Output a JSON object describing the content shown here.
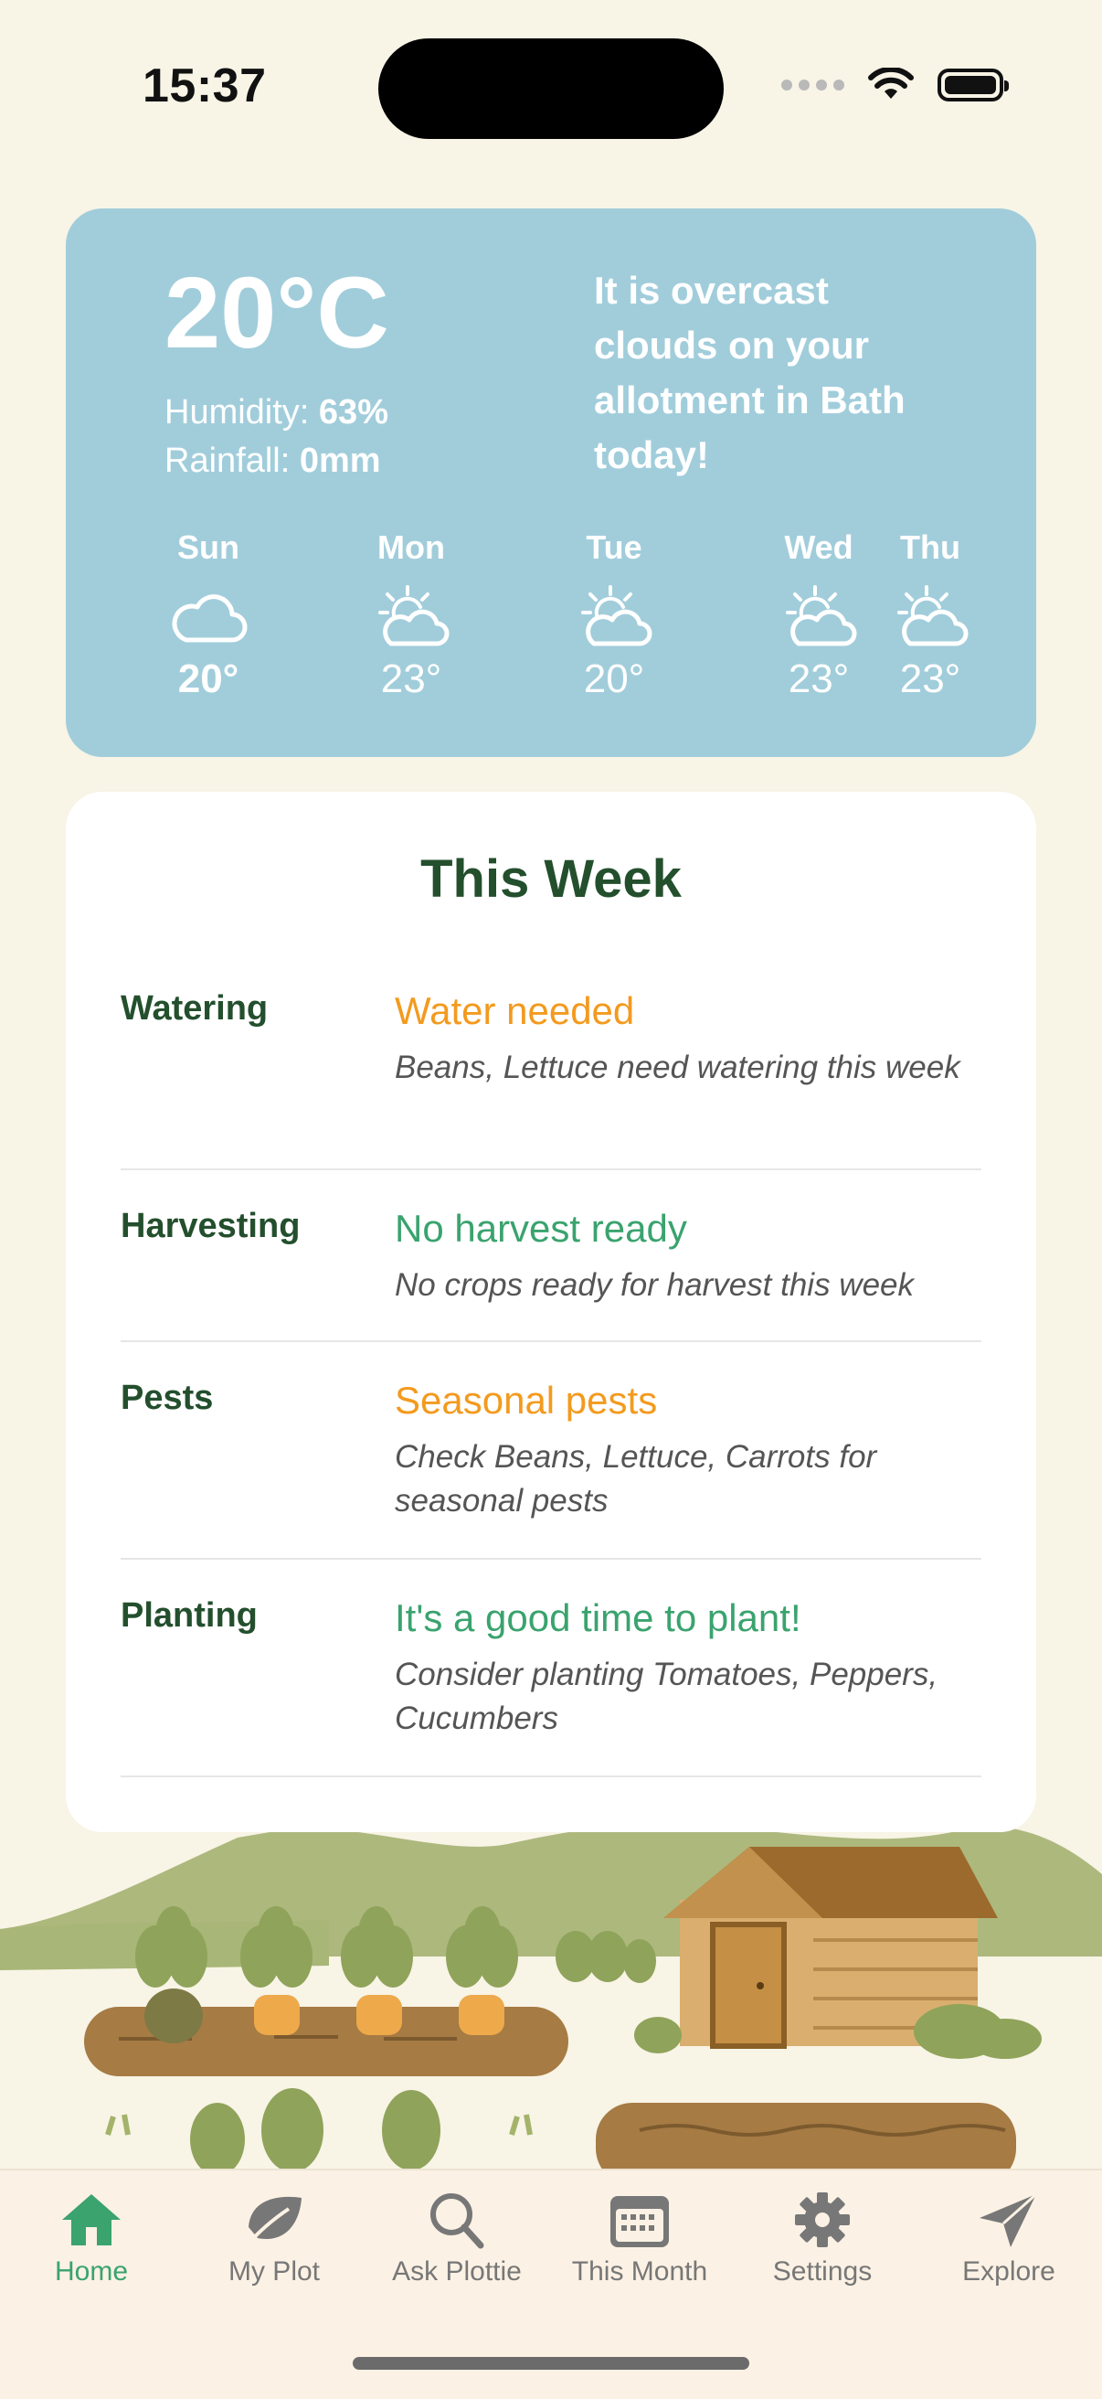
{
  "status_bar": {
    "time": "15:37"
  },
  "weather": {
    "temperature": "20°C",
    "humidity_label": "Humidity: ",
    "humidity_value": "63%",
    "rainfall_label": "Rainfall: ",
    "rainfall_value": "0mm",
    "summary": "It is overcast clouds on your allotment in Bath today!",
    "forecast": [
      {
        "day": "Sun",
        "temp": "20°",
        "icon": "cloud-icon"
      },
      {
        "day": "Mon",
        "temp": "23°",
        "icon": "partly-sunny-icon"
      },
      {
        "day": "Tue",
        "temp": "20°",
        "icon": "partly-sunny-icon"
      },
      {
        "day": "Wed",
        "temp": "23°",
        "icon": "partly-sunny-icon"
      },
      {
        "day": "Thu",
        "temp": "23°",
        "icon": "partly-sunny-icon"
      }
    ]
  },
  "this_week": {
    "title": "This Week",
    "rows": [
      {
        "label": "Watering",
        "status": "Water needed",
        "status_color": "#F39A1E",
        "detail": "Beans, Lettuce need watering this week"
      },
      {
        "label": "Harvesting",
        "status": "No harvest ready",
        "status_color": "#3AA36E",
        "detail": "No crops ready for harvest this week"
      },
      {
        "label": "Pests",
        "status": "Seasonal pests",
        "status_color": "#F39A1E",
        "detail": "Check Beans, Lettuce, Carrots for seasonal pests"
      },
      {
        "label": "Planting",
        "status": "It's a good time to plant!",
        "status_color": "#3AA36E",
        "detail": "Consider planting Tomatoes, Peppers, Cucumbers"
      }
    ]
  },
  "tabs": [
    {
      "label": "Home",
      "icon": "home-icon",
      "active": true
    },
    {
      "label": "My Plot",
      "icon": "leaf-icon",
      "active": false
    },
    {
      "label": "Ask Plottie",
      "icon": "search-icon",
      "active": false
    },
    {
      "label": "This Month",
      "icon": "calendar-icon",
      "active": false
    },
    {
      "label": "Settings",
      "icon": "gear-icon",
      "active": false
    },
    {
      "label": "Explore",
      "icon": "paper-plane-icon",
      "active": false
    }
  ],
  "colors": {
    "background": "#F8F4E6",
    "weather_card": "#A1CDDB",
    "heading_green": "#234F2D",
    "accent_green": "#3AA36E",
    "accent_orange": "#F39A1E"
  }
}
